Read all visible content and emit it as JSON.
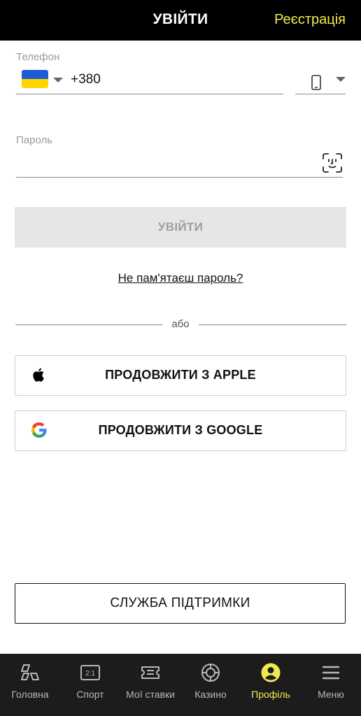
{
  "header": {
    "title": "УВІЙТИ",
    "register_label": "Реєстрація"
  },
  "phone": {
    "label": "Телефон",
    "country_code": "+380",
    "flag": "ukraine-flag",
    "device_icon": "smartphone-icon"
  },
  "password": {
    "label": "Пароль",
    "biometric_icon": "face-id-icon"
  },
  "login_button": "УВІЙТИ",
  "forgot_password": "Не пам'ятаєш пароль?",
  "or_text": "або",
  "social": {
    "apple_label": "ПРОДОВЖИТИ З APPLE",
    "google_label": "ПРОДОВЖИТИ З GOOGLE"
  },
  "support_button": "СЛУЖБА ПІДТРИМКИ",
  "nav": {
    "items": [
      {
        "label": "Головна",
        "icon": "home-icon"
      },
      {
        "label": "Спорт",
        "icon": "scoreboard-icon"
      },
      {
        "label": "Мої ставки",
        "icon": "ticket-icon"
      },
      {
        "label": "Казино",
        "icon": "casino-chip-icon"
      },
      {
        "label": "Профіль",
        "icon": "profile-icon",
        "active": true
      },
      {
        "label": "Меню",
        "icon": "menu-icon"
      }
    ]
  },
  "colors": {
    "accent": "#f2e94e",
    "header_bg": "#000000",
    "nav_bg": "#1c1c1c",
    "disabled_button_bg": "#e6e6e6"
  }
}
